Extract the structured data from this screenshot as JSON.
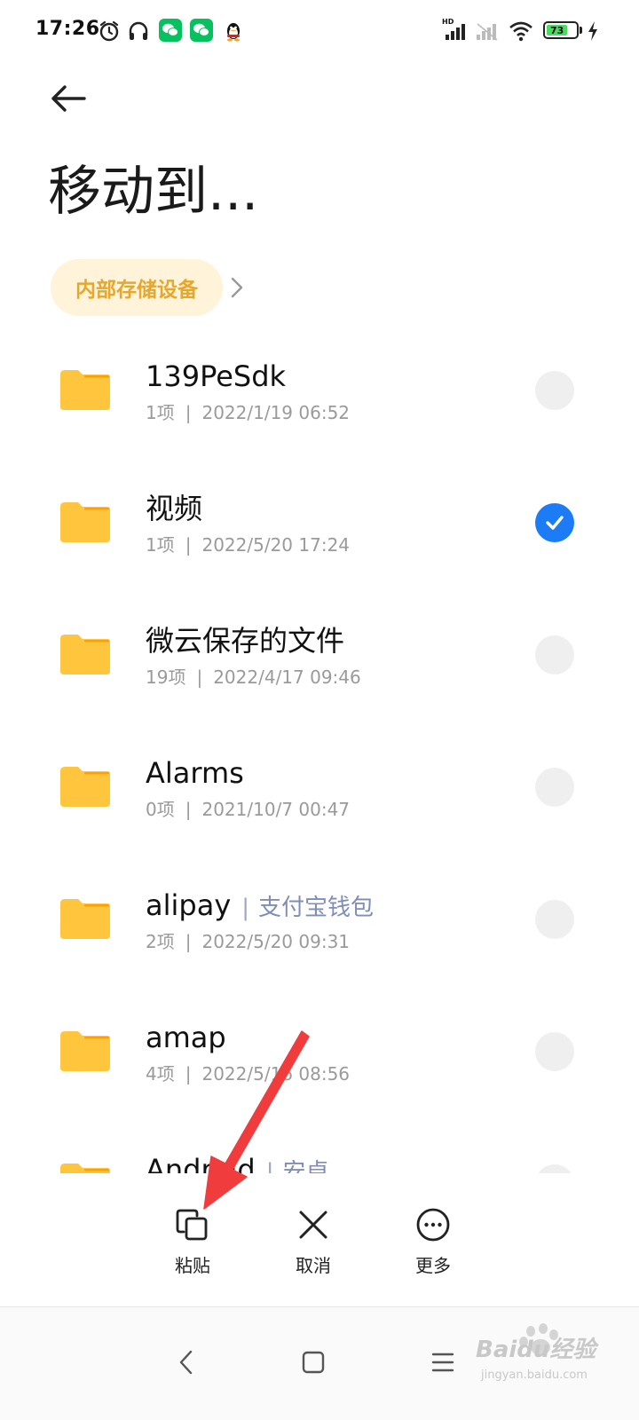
{
  "status_bar": {
    "time": "17:26",
    "network_label": "HD",
    "battery_level": "73",
    "icons": [
      "alarm-icon",
      "headphones-icon",
      "wechat-icon",
      "wechat-icon",
      "qq-penguin-icon",
      "signal-icon",
      "signal-weak-icon",
      "wifi-icon",
      "battery-icon",
      "charging-icon"
    ]
  },
  "header": {
    "back_icon": "arrow-left-icon",
    "title": "移动到...",
    "breadcrumb": "内部存储设备",
    "breadcrumb_chevron": "chevron-right-icon"
  },
  "colors": {
    "folder": "#FFC53D",
    "accent_blue": "#1C7CF5",
    "breadcrumb_text": "#E8A72A",
    "breadcrumb_bg": "#FFF3D9",
    "annotation_arrow": "#F03C3C"
  },
  "files": [
    {
      "name": "139PeSdk",
      "alias": "",
      "count": "1项",
      "date": "2022/1/19 06:52",
      "selected": false
    },
    {
      "name": "视频",
      "alias": "",
      "count": "1项",
      "date": "2022/5/20 17:24",
      "selected": true
    },
    {
      "name": "微云保存的文件",
      "alias": "",
      "count": "19项",
      "date": "2022/4/17 09:46",
      "selected": false
    },
    {
      "name": "Alarms",
      "alias": "",
      "count": "0项",
      "date": "2021/10/7 00:47",
      "selected": false
    },
    {
      "name": "alipay",
      "alias": "支付宝钱包",
      "count": "2项",
      "date": "2022/5/20 09:31",
      "selected": false
    },
    {
      "name": "amap",
      "alias": "",
      "count": "4项",
      "date": "2022/5/16 08:56",
      "selected": false
    },
    {
      "name": "Android",
      "alias": "安卓",
      "count": "",
      "date": "",
      "selected": false
    }
  ],
  "actions": {
    "paste_label": "粘贴",
    "cancel_label": "取消",
    "more_label": "更多"
  },
  "nav": {
    "icons": [
      "nav-back-icon",
      "nav-home-icon",
      "nav-menu-icon"
    ]
  },
  "watermark": {
    "text": "Baidu经验",
    "sub": "jingyan.baidu.com"
  }
}
